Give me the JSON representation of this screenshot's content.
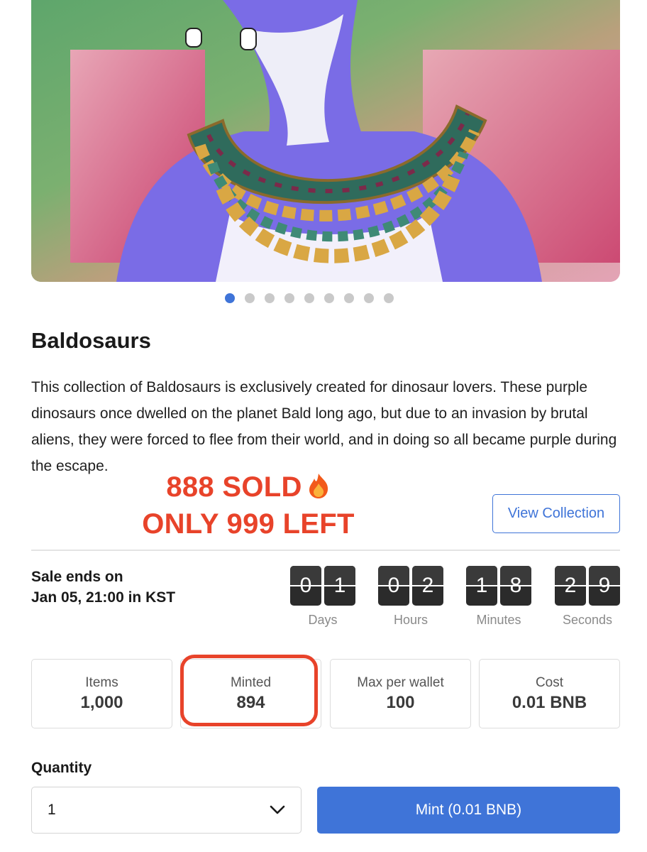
{
  "carousel": {
    "slide_count": 9,
    "active_index": 0
  },
  "collection": {
    "title": "Baldosaurs",
    "description": "This collection of Baldosaurs is exclusively created for dinosaur lovers. These purple dinosaurs once dwelled on the planet Bald long ago, but due to an invasion by brutal aliens, they were forced to flee from their world, and in doing so all became purple during the escape."
  },
  "promo": {
    "line1": "888 SOLD",
    "line2": "ONLY 999 LEFT",
    "icon": "fire-icon"
  },
  "view_collection_label": "View Collection",
  "sale": {
    "line1": "Sale ends on",
    "line2": "Jan 05, 21:00 in KST"
  },
  "countdown": [
    {
      "d1": "0",
      "d2": "1",
      "unit": "Days"
    },
    {
      "d1": "0",
      "d2": "2",
      "unit": "Hours"
    },
    {
      "d1": "1",
      "d2": "8",
      "unit": "Minutes"
    },
    {
      "d1": "2",
      "d2": "9",
      "unit": "Seconds"
    }
  ],
  "stats": [
    {
      "label": "Items",
      "value": "1,000"
    },
    {
      "label": "Minted",
      "value": "894"
    },
    {
      "label": "Max per wallet",
      "value": "100"
    },
    {
      "label": "Cost",
      "value": "0.01 BNB"
    }
  ],
  "quantity": {
    "label": "Quantity",
    "value": "1"
  },
  "mint_label": "Mint (0.01 BNB)",
  "colors": {
    "accent": "#3f74d8",
    "promo": "#e8432a",
    "timer_bg": "#2b2b2b"
  }
}
